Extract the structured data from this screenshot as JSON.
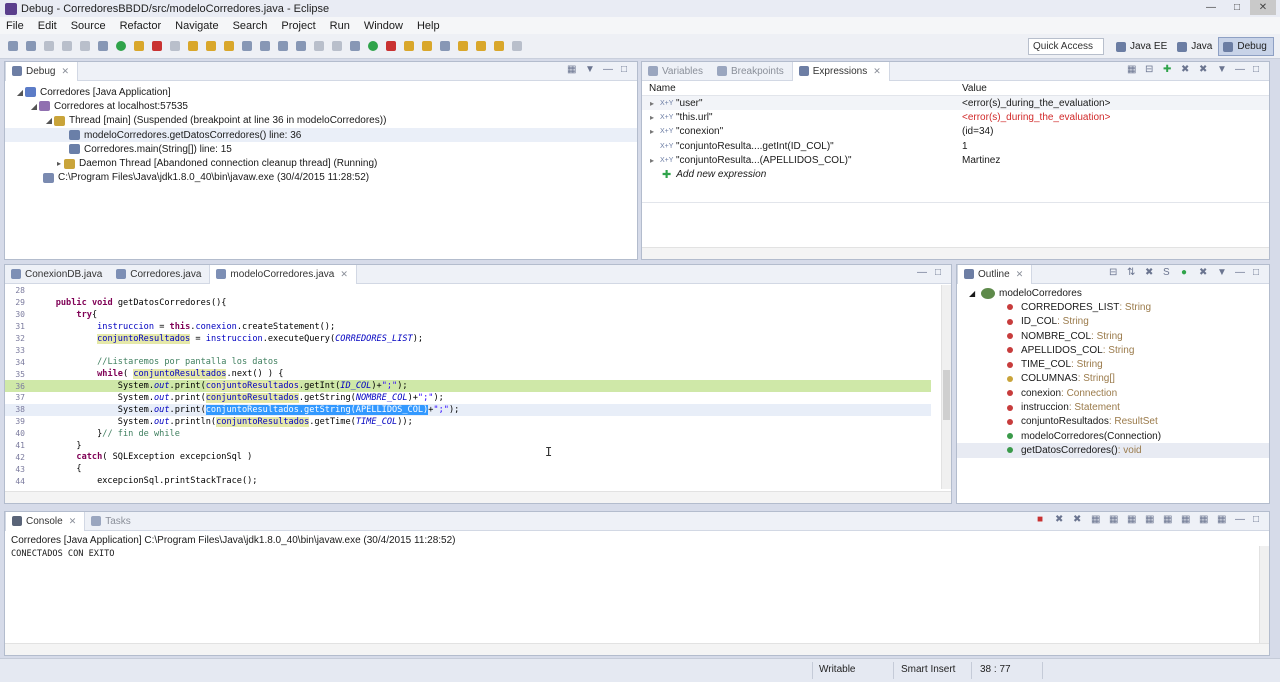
{
  "window": {
    "title": "Debug - CorredoresBBDD/src/modeloCorredores.java - Eclipse"
  },
  "menu": [
    "File",
    "Edit",
    "Source",
    "Refactor",
    "Navigate",
    "Search",
    "Project",
    "Run",
    "Window",
    "Help"
  ],
  "toolbar": {
    "quick_access": "Quick Access",
    "perspectives": [
      {
        "label": "Java EE",
        "active": false
      },
      {
        "label": "Java",
        "active": false
      },
      {
        "label": "Debug",
        "active": true
      }
    ]
  },
  "debug_view": {
    "tab_label": "Debug",
    "tree": [
      {
        "label": "Corredores [Java Application]"
      },
      {
        "label": "Corredores at localhost:57535"
      },
      {
        "label": "Thread [main] (Suspended (breakpoint at line 36 in modeloCorredores))"
      },
      {
        "label": "modeloCorredores.getDatosCorredores() line: 36"
      },
      {
        "label": "Corredores.main(String[]) line: 15"
      },
      {
        "label": "Daemon Thread [Abandoned connection cleanup thread] (Running)"
      },
      {
        "label": "C:\\Program Files\\Java\\jdk1.8.0_40\\bin\\javaw.exe (30/4/2015 11:28:52)"
      }
    ]
  },
  "expressions_view": {
    "tabs": [
      "Variables",
      "Breakpoints",
      "Expressions"
    ],
    "header": {
      "name": "Name",
      "value": "Value"
    },
    "rows": [
      {
        "name": "\"user\"",
        "value": "<error(s)_during_the_evaluation>",
        "error": false
      },
      {
        "name": "\"this.url\"",
        "value": "<error(s)_during_the_evaluation>",
        "error": true
      },
      {
        "name": "\"conexion\"",
        "value": "(id=34)",
        "error": false
      },
      {
        "name": "\"conjuntoResulta....getInt(ID_COL)\"",
        "value": "1",
        "error": false
      },
      {
        "name": "\"conjuntoResulta...(APELLIDOS_COL)\"",
        "value": "Martinez",
        "error": false
      }
    ],
    "add_new": "Add new expression"
  },
  "editor": {
    "tabs": [
      "ConexionDB.java",
      "Corredores.java",
      "modeloCorredores.java"
    ],
    "active_tab": 2,
    "line_numbers": [
      "28",
      "29",
      "30",
      "31",
      "32",
      "33",
      "34",
      "35",
      "36",
      "37",
      "38",
      "39",
      "40",
      "41",
      "42",
      "43",
      "44"
    ]
  },
  "outline": {
    "tab_label": "Outline",
    "root": "modeloCorredores",
    "items": [
      {
        "label": "CORREDORES_LIST",
        "type": " : String",
        "color": "#c73c3c"
      },
      {
        "label": "ID_COL",
        "type": " : String",
        "color": "#c73c3c"
      },
      {
        "label": "NOMBRE_COL",
        "type": " : String",
        "color": "#c73c3c"
      },
      {
        "label": "APELLIDOS_COL",
        "type": " : String",
        "color": "#c73c3c"
      },
      {
        "label": "TIME_COL",
        "type": " : String",
        "color": "#c73c3c"
      },
      {
        "label": "COLUMNAS",
        "type": " : String[]",
        "color": "#c73c3c"
      },
      {
        "label": "conexion",
        "type": " : Connection",
        "color": "#c73c3c"
      },
      {
        "label": "instruccion",
        "type": " : Statement",
        "color": "#c73c3c"
      },
      {
        "label": "conjuntoResultados",
        "type": " : ResultSet",
        "color": "#c73c3c"
      },
      {
        "label": "modeloCorredores(Connection)",
        "type": "",
        "color": "#3a9a4a"
      },
      {
        "label": "getDatosCorredores()",
        "type": " : void",
        "color": "#3a9a4a"
      }
    ]
  },
  "console": {
    "tabs": [
      "Console",
      "Tasks"
    ],
    "launch": "Corredores [Java Application] C:\\Program Files\\Java\\jdk1.8.0_40\\bin\\javaw.exe (30/4/2015 11:28:52)",
    "output": "CONECTADOS CON EXITO"
  },
  "statusbar": {
    "writable": "Writable",
    "insert_mode": "Smart Insert",
    "position": "38 : 77"
  }
}
